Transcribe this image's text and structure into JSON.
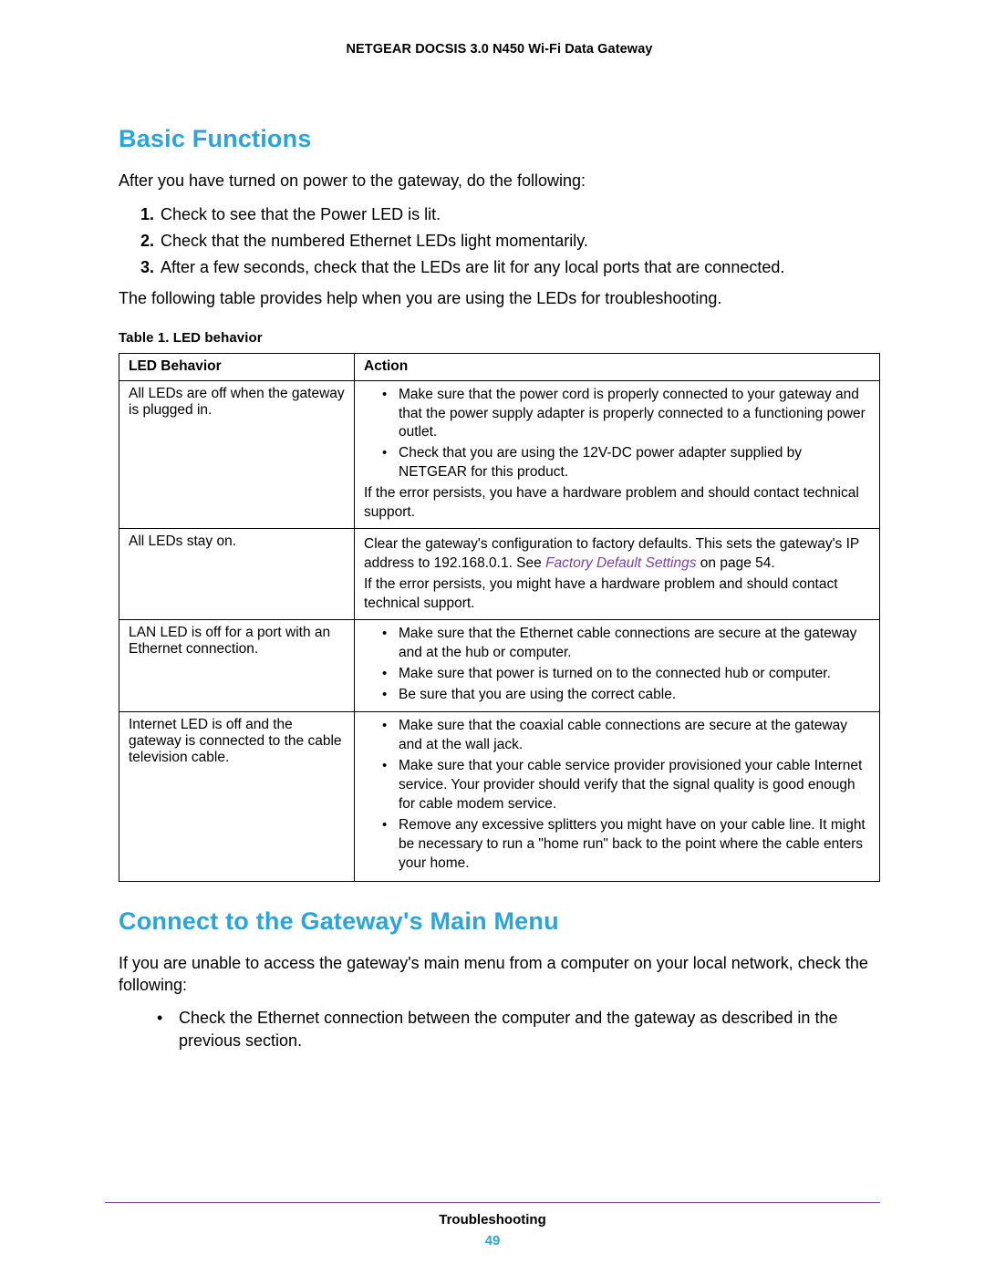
{
  "header": {
    "product": "NETGEAR DOCSIS 3.0 N450 Wi-Fi Data Gateway"
  },
  "section1": {
    "title": "Basic Functions",
    "intro": "After you have turned on power to the gateway, do the following:",
    "steps": [
      "Check to see that the Power LED is lit.",
      "Check that the numbered Ethernet LEDs light momentarily.",
      "After a few seconds, check that the LEDs are lit for any local ports that are connected."
    ],
    "afterSteps": "The following table provides help when you are using the LEDs for troubleshooting."
  },
  "table": {
    "caption": "Table 1.  LED behavior",
    "headers": {
      "col1": "LED Behavior",
      "col2": "Action"
    },
    "rows": [
      {
        "behavior": "All LEDs are off when the gateway is plugged in.",
        "bullets": [
          "Make sure that the power cord is properly connected to your gateway and that the power supply adapter is properly connected to a functioning power outlet.",
          "Check that you are using the 12V-DC power adapter supplied by NETGEAR for this product."
        ],
        "trailing": "If the error persists, you have a hardware problem and should contact technical support."
      },
      {
        "behavior": "All LEDs stay on.",
        "plainParts": {
          "pre": "Clear the gateway's configuration to factory defaults. This sets the gateway's IP address to 192.168.0.1. See ",
          "xref": "Factory Default Settings",
          "post": " on page 54."
        },
        "trailing": "If the error persists, you might have a hardware problem and should contact technical support."
      },
      {
        "behavior": "LAN LED is off for a port with an Ethernet connection.",
        "bullets": [
          "Make sure that the Ethernet cable connections are secure at the gateway and at the hub or computer.",
          "Make sure that power is turned on to the connected hub or computer.",
          "Be sure that you are using the correct cable."
        ]
      },
      {
        "behavior": "Internet LED is off and the gateway is connected to the cable television cable.",
        "bullets": [
          "Make sure that the coaxial cable connections are secure at the gateway and at the wall jack.",
          "Make sure that your cable service provider provisioned your cable Internet service. Your provider should verify that the signal quality is good enough for cable modem service.",
          "Remove any excessive splitters you might have on your cable line. It might be necessary to run a \"home run\" back to the point where the cable enters your home."
        ]
      }
    ]
  },
  "section2": {
    "title": "Connect to the Gateway's Main Menu",
    "intro": "If you are unable to access the gateway's main menu from a computer on your local network, check the following:",
    "bullets": [
      "Check the Ethernet connection between the computer and the gateway as described in the previous section."
    ]
  },
  "footer": {
    "chapter": "Troubleshooting",
    "page": "49"
  }
}
